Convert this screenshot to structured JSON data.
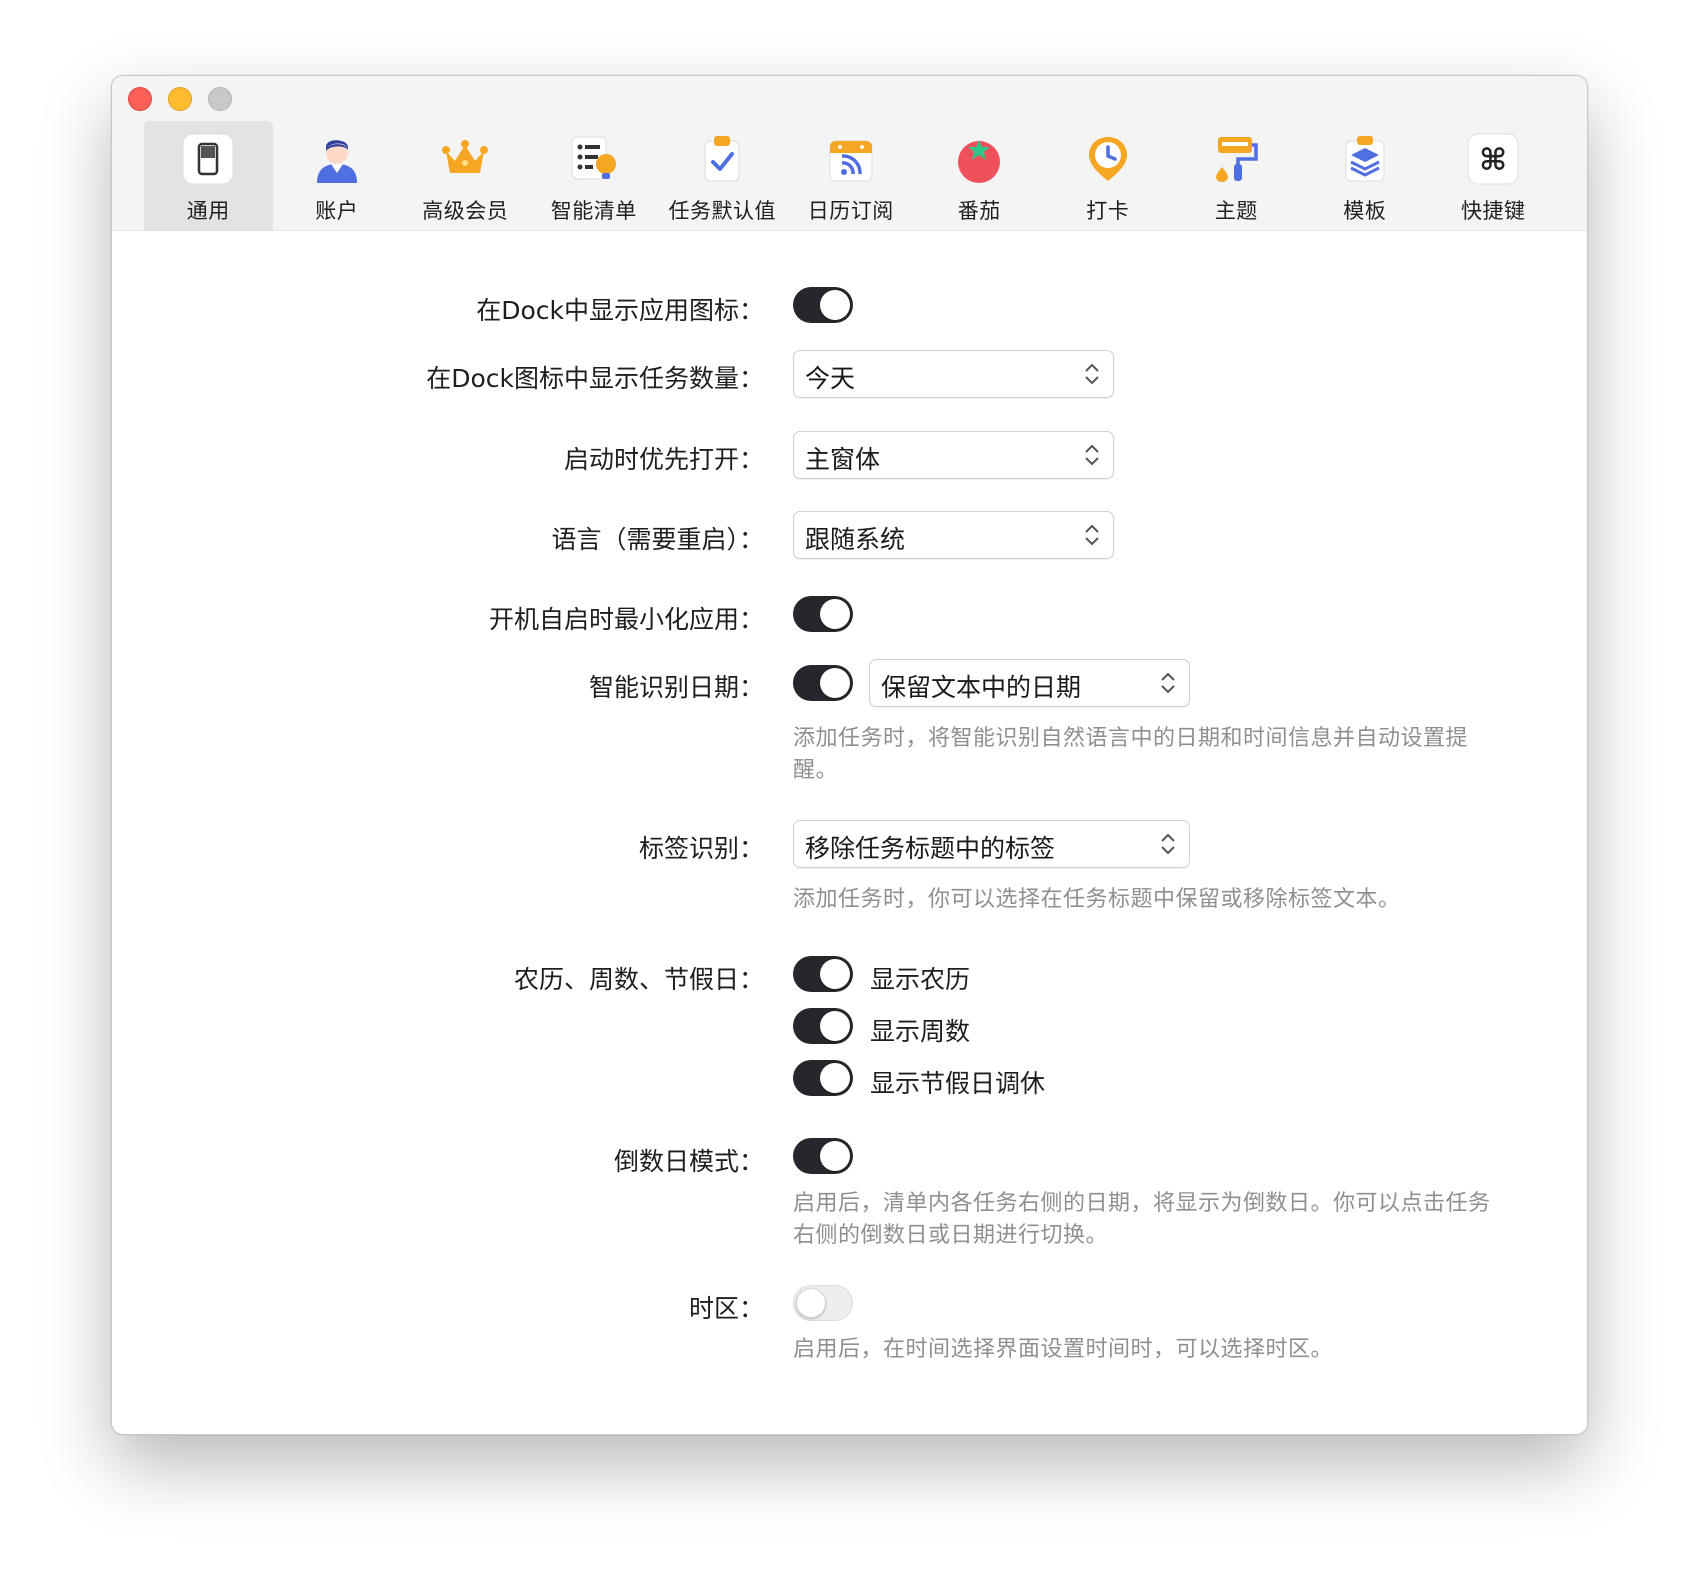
{
  "tabs": [
    {
      "label": "通用",
      "icon": "general-icon"
    },
    {
      "label": "账户",
      "icon": "account-icon"
    },
    {
      "label": "高级会员",
      "icon": "premium-crown-icon"
    },
    {
      "label": "智能清单",
      "icon": "smart-list-icon"
    },
    {
      "label": "任务默认值",
      "icon": "task-default-icon"
    },
    {
      "label": "日历订阅",
      "icon": "calendar-subscribe-icon"
    },
    {
      "label": "番茄",
      "icon": "tomato-icon"
    },
    {
      "label": "打卡",
      "icon": "habit-checkin-icon"
    },
    {
      "label": "主题",
      "icon": "theme-brush-icon"
    },
    {
      "label": "模板",
      "icon": "template-icon"
    },
    {
      "label": "快捷键",
      "icon": "command-key-icon"
    }
  ],
  "settings": {
    "dock_icon": {
      "label": "在Dock中显示应用图标：",
      "on": true
    },
    "dock_badge": {
      "label": "在Dock图标中显示任务数量：",
      "value": "今天"
    },
    "launch_open": {
      "label": "启动时优先打开：",
      "value": "主窗体"
    },
    "language": {
      "label": "语言（需要重启）：",
      "value": "跟随系统"
    },
    "minimize_on_login": {
      "label": "开机自启时最小化应用：",
      "on": true
    },
    "smart_date": {
      "label": "智能识别日期：",
      "on": true,
      "value": "保留文本中的日期",
      "help": "添加任务时，将智能识别自然语言中的日期和时间信息并自动设置提醒。"
    },
    "tag_recognition": {
      "label": "标签识别：",
      "value": "移除任务标题中的标签",
      "help": "添加任务时，你可以选择在任务标题中保留或移除标签文本。"
    },
    "calendar_extras": {
      "label": "农历、周数、节假日：",
      "options": [
        {
          "text": "显示农历",
          "on": true
        },
        {
          "text": "显示周数",
          "on": true
        },
        {
          "text": "显示节假日调休",
          "on": true
        }
      ]
    },
    "countdown": {
      "label": "倒数日模式：",
      "on": true,
      "help": "启用后，清单内各任务右侧的日期，将显示为倒数日。你可以点击任务右侧的倒数日或日期进行切换。"
    },
    "timezone": {
      "label": "时区：",
      "on": false,
      "help": "启用后，在时间选择界面设置时间时，可以选择时区。"
    }
  }
}
